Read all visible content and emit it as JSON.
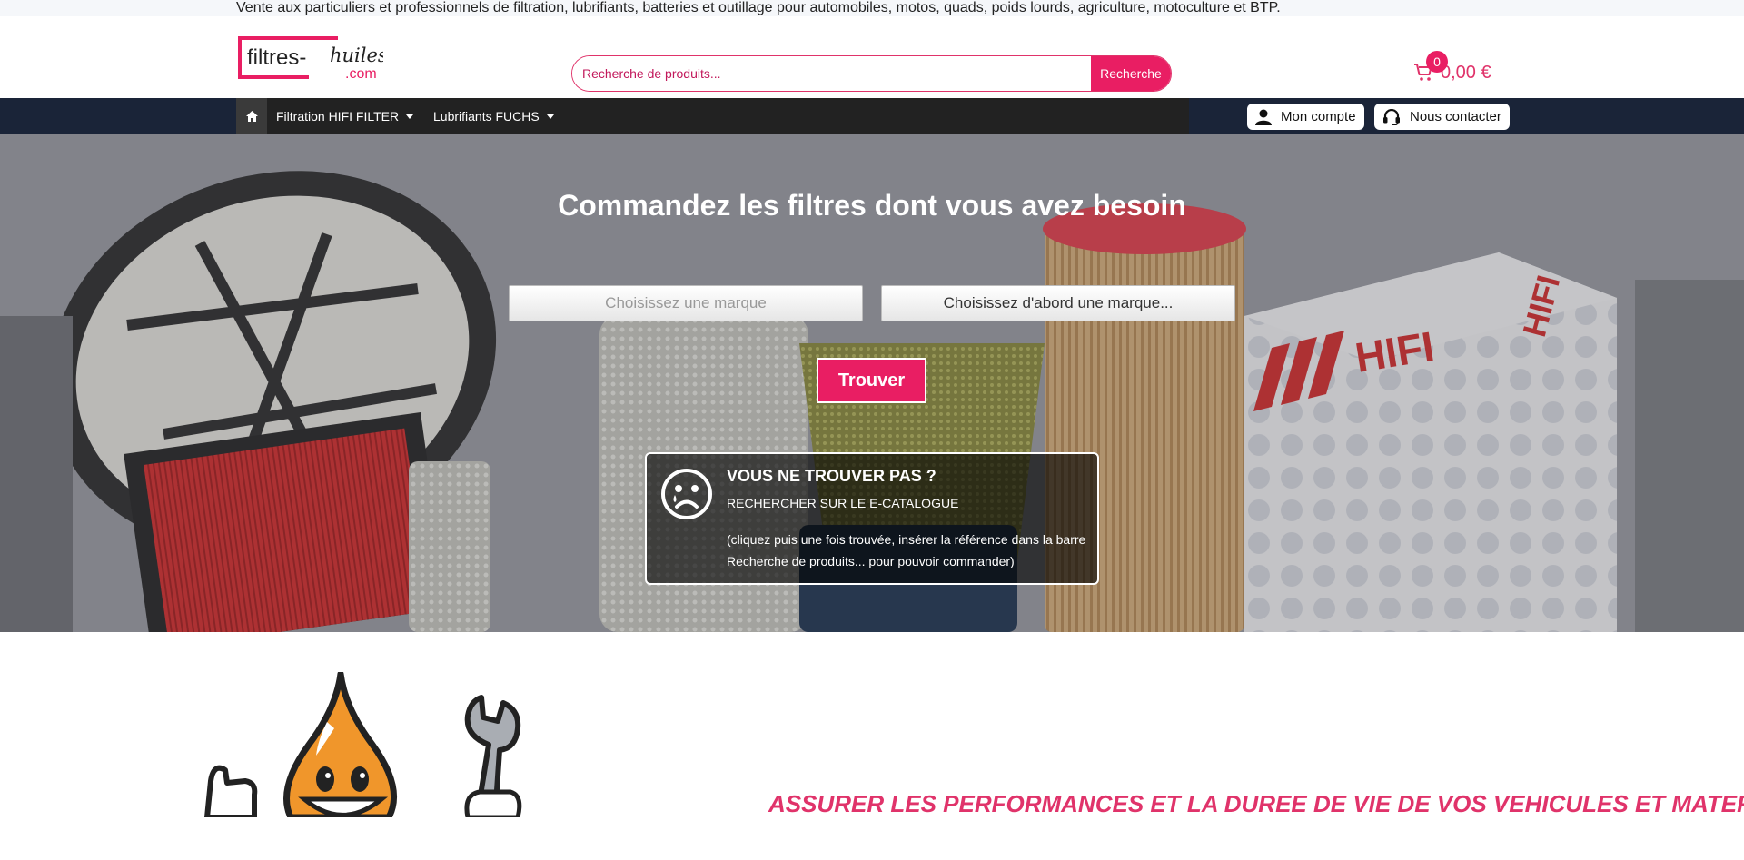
{
  "topbar": {
    "text": "Vente aux particuliers et professionnels de filtration, lubrifiants, batteries et outillage pour automobiles, motos, quads, poids lourds, agriculture, motoculture et BTP."
  },
  "header": {
    "logo_text_main": "filtres-",
    "logo_text_script": "huiles",
    "logo_text_domain": ".com",
    "search_placeholder": "Recherche de produits...",
    "search_button": "Recherche",
    "cart_count": "0",
    "cart_amount": "0,00 €"
  },
  "nav": {
    "home_icon": "home-icon",
    "items": [
      {
        "label": "Filtration HIFI FILTER"
      },
      {
        "label": "Lubrifiants FUCHS"
      }
    ],
    "account_label": "Mon compte",
    "contact_label": "Nous contacter"
  },
  "hero": {
    "title": "Commandez les filtres dont vous avez besoin",
    "brand_select": "Choisissez une marque",
    "model_select": "Choisissez d'abord une marque...",
    "find_button": "Trouver",
    "notfound_title": "VOUS NE TROUVER PAS ?",
    "notfound_sub": "RECHERCHER SUR LE E-CATALOGUE",
    "notfound_note": "(cliquez puis une fois trouvée, insérer la référence dans la barre Recherche de produits... pour pouvoir commander)",
    "box_brand_text": "HIFI"
  },
  "bottom": {
    "slogan": "ASSURER LES PERFORMANCES ET LA DUREE DE VIE DE VOS VEHICULES ET MATERIELS"
  },
  "colors": {
    "brand_pink": "#e91e63",
    "nav_dark": "#1a2438",
    "oil_orange": "#f0962b"
  }
}
